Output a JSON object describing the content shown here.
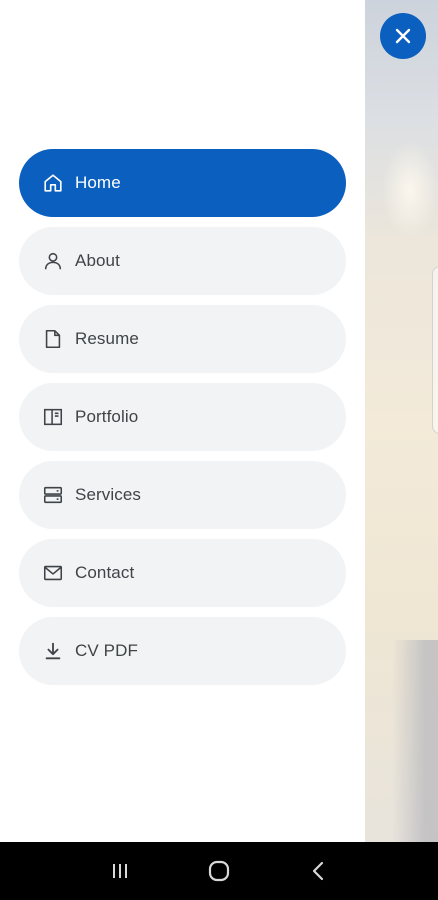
{
  "menu": {
    "items": [
      {
        "label": "Home",
        "icon": "home-icon",
        "active": true
      },
      {
        "label": "About",
        "icon": "person-icon",
        "active": false
      },
      {
        "label": "Resume",
        "icon": "file-icon",
        "active": false
      },
      {
        "label": "Portfolio",
        "icon": "book-icon",
        "active": false
      },
      {
        "label": "Services",
        "icon": "server-icon",
        "active": false
      },
      {
        "label": "Contact",
        "icon": "envelope-icon",
        "active": false
      },
      {
        "label": "CV PDF",
        "icon": "download-icon",
        "active": false
      }
    ]
  },
  "colors": {
    "accent": "#0a5fbf",
    "item_bg": "#f2f3f5",
    "text": "#3f4448"
  },
  "close_button": {
    "icon": "close-icon"
  },
  "system_nav": {
    "recents_icon": "recents-icon",
    "home_icon": "home-circle-icon",
    "back_icon": "back-icon"
  }
}
